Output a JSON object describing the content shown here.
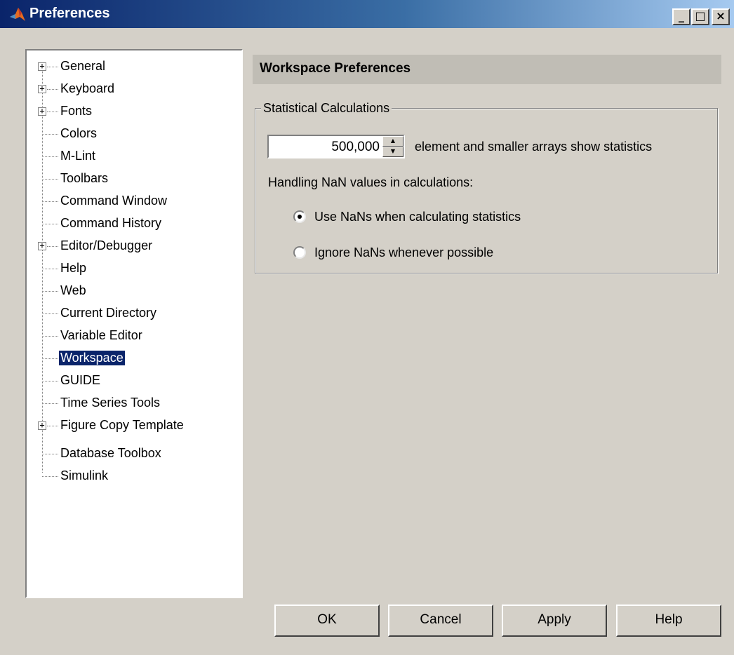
{
  "window": {
    "title": "Preferences",
    "app_icon": "matlab-logo-icon",
    "controls": {
      "minimize": "_",
      "maximize": "□",
      "close": "×"
    }
  },
  "tree": {
    "items": [
      {
        "label": "General",
        "expandable": true,
        "selected": false
      },
      {
        "label": "Keyboard",
        "expandable": true,
        "selected": false
      },
      {
        "label": "Fonts",
        "expandable": true,
        "selected": false
      },
      {
        "label": "Colors",
        "expandable": false,
        "selected": false
      },
      {
        "label": "M-Lint",
        "expandable": false,
        "selected": false
      },
      {
        "label": "Toolbars",
        "expandable": false,
        "selected": false
      },
      {
        "label": "Command Window",
        "expandable": false,
        "selected": false
      },
      {
        "label": "Command History",
        "expandable": false,
        "selected": false
      },
      {
        "label": "Editor/Debugger",
        "expandable": true,
        "selected": false
      },
      {
        "label": "Help",
        "expandable": false,
        "selected": false
      },
      {
        "label": "Web",
        "expandable": false,
        "selected": false
      },
      {
        "label": "Current Directory",
        "expandable": false,
        "selected": false
      },
      {
        "label": "Variable Editor",
        "expandable": false,
        "selected": false
      },
      {
        "label": "Workspace",
        "expandable": false,
        "selected": true
      },
      {
        "label": "GUIDE",
        "expandable": false,
        "selected": false
      },
      {
        "label": "Time Series Tools",
        "expandable": false,
        "selected": false
      },
      {
        "label": "Figure Copy Template",
        "expandable": true,
        "selected": false
      },
      {
        "label": "Database Toolbox",
        "expandable": false,
        "selected": false
      },
      {
        "label": "Simulink",
        "expandable": false,
        "selected": false
      }
    ]
  },
  "panel": {
    "header": "Workspace Preferences",
    "group_title": "Statistical Calculations",
    "spinner_value": "500,000",
    "spinner_suffix": "element and smaller arrays show statistics",
    "handling_label": "Handling NaN values in calculations:",
    "radios": [
      {
        "label": "Use NaNs when calculating statistics",
        "checked": true
      },
      {
        "label": "Ignore NaNs whenever possible",
        "checked": false
      }
    ]
  },
  "buttons": {
    "ok": "OK",
    "cancel": "Cancel",
    "apply": "Apply",
    "help": "Help"
  },
  "colors": {
    "selection": "#0a246a",
    "dialog_bg": "#d4d0c8",
    "header_bg": "#c0bdb5"
  }
}
